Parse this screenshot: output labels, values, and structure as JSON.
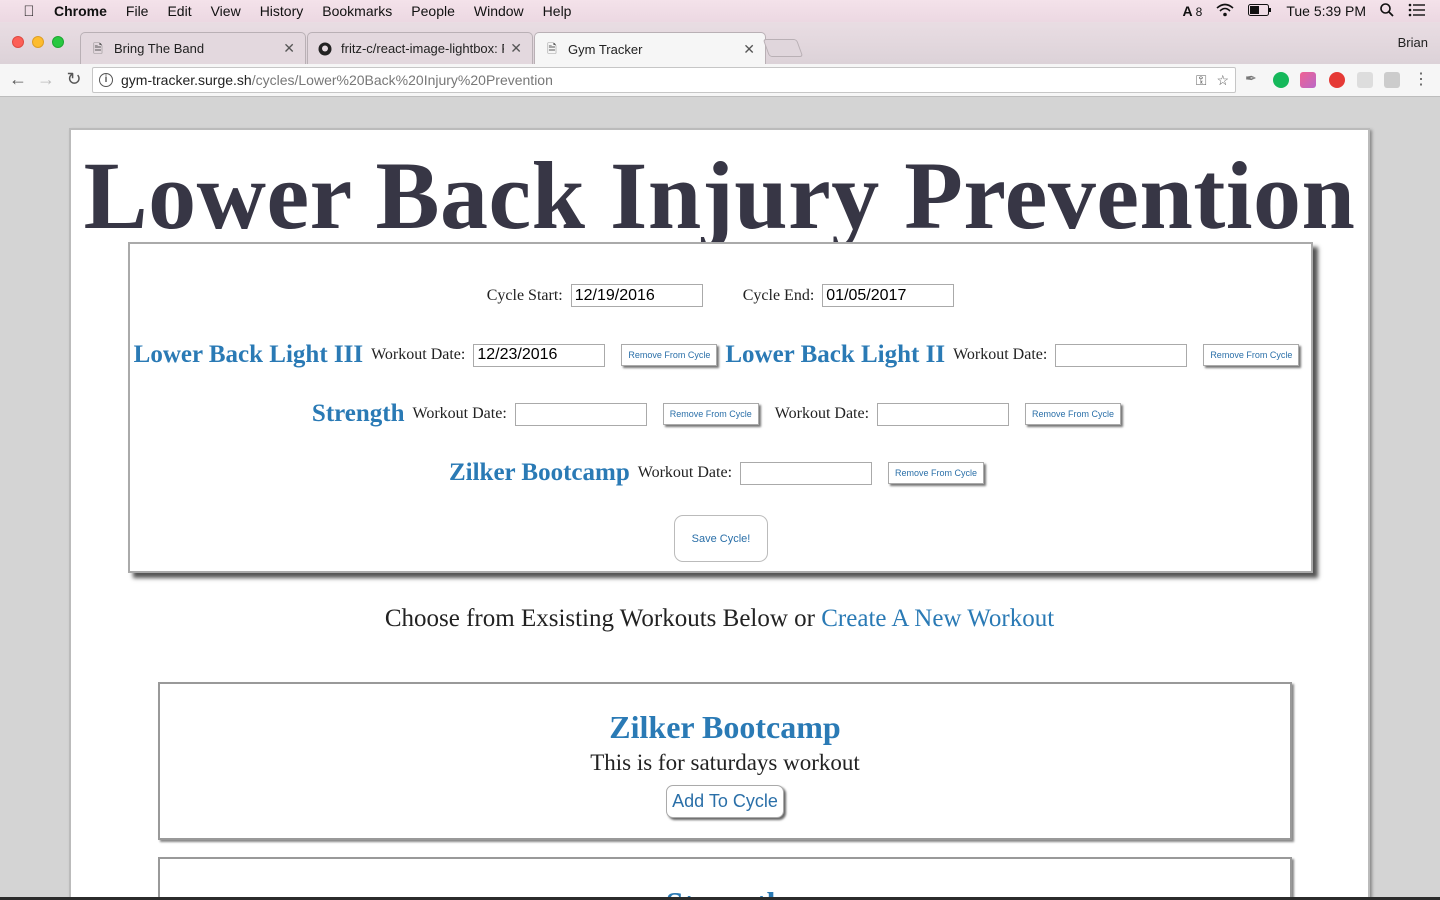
{
  "menubar": {
    "app": "Chrome",
    "items": [
      "File",
      "Edit",
      "View",
      "History",
      "Bookmarks",
      "People",
      "Window",
      "Help"
    ],
    "adobe_count": "8",
    "clock": "Tue 5:39 PM"
  },
  "tabs": [
    {
      "title": "Bring The Band"
    },
    {
      "title": "fritz-c/react-image-lightbox: R"
    },
    {
      "title": "Gym Tracker"
    }
  ],
  "profile": "Brian",
  "url": {
    "host": "gym-tracker.surge.sh",
    "path": "/cycles/Lower%20Back%20Injury%20Prevention"
  },
  "page": {
    "title": "Lower Back Injury Prevention",
    "cycle": {
      "start_label": "Cycle Start:",
      "start_value": "12/19/2016",
      "end_label": "Cycle End:",
      "end_value": "01/05/2017",
      "workout_date_label": "Workout Date:",
      "remove_label": "Remove From Cycle",
      "save_label": "Save Cycle!",
      "workouts": [
        {
          "name": "Lower Back Light III",
          "date": "12/23/2016"
        },
        {
          "name": "Lower Back Light II",
          "date": ""
        },
        {
          "name": "Strength",
          "date": ""
        },
        {
          "name": "",
          "date": ""
        },
        {
          "name": "Zilker Bootcamp",
          "date": ""
        }
      ]
    },
    "choose_text": "Choose from Exsisting Workouts Below or",
    "create_link": "Create A New Workout",
    "existing_workouts": [
      {
        "title": "Zilker Bootcamp",
        "description": "This is for saturdays workout",
        "add_label": "Add To Cycle"
      },
      {
        "title": "Strength"
      }
    ]
  }
}
